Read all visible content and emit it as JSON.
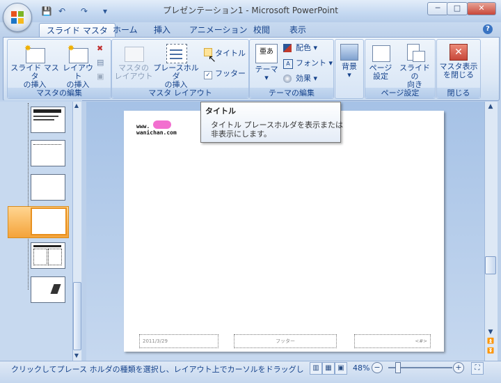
{
  "window": {
    "title": "プレゼンテーション1 - Microsoft PowerPoint",
    "minimize": "─",
    "maximize": "□",
    "close": "✕"
  },
  "quick_access": {
    "save": "💾",
    "undo": "↶",
    "redo": "↷",
    "customize": "▾"
  },
  "tabs": [
    "スライド マスタ",
    "ホーム",
    "挿入",
    "アニメーション",
    "校閲",
    "表示"
  ],
  "ribbon": {
    "group_master_edit": {
      "label": "マスタの編集",
      "insert_master_line1": "スライド マスタ",
      "insert_master_line2": "の挿入",
      "insert_layout_line1": "レイアウト",
      "insert_layout_line2": "の挿入"
    },
    "group_master_layout": {
      "label": "マスタ レイアウト",
      "master_layout_line1": "マスタの",
      "master_layout_line2": "レイアウト",
      "placeholder_line1": "プレースホルダ",
      "placeholder_line2": "の挿入",
      "title_check": "タイトル",
      "footer_check": "フッター"
    },
    "group_theme_edit": {
      "label": "テーマの編集",
      "theme": "テーマ",
      "colors": "配色",
      "fonts": "フォント",
      "effects": "効果",
      "theme_icon_text": "亜あ"
    },
    "group_background": {
      "background": "背景"
    },
    "group_page_setup": {
      "label": "ページ設定",
      "page_setup_line1": "ページ",
      "page_setup_line2": "設定",
      "orientation_line1": "スライドの",
      "orientation_line2": "向き"
    },
    "group_close": {
      "label": "閉じる",
      "close_line1": "マスタ表示",
      "close_line2": "を閉じる"
    }
  },
  "tooltip": {
    "title": "タイトル",
    "line1": "タイトル プレースホルダを表示または",
    "line2": "非表示にします。"
  },
  "slide": {
    "logo_line1": "www.",
    "logo_line2": "wanichan.com",
    "date": "2011/3/29",
    "footer": "フッター",
    "page_number": "<#>"
  },
  "status": {
    "message": "クリックしてプレース ホルダの種類を選択し、レイアウト上でカーソルをドラッグしてプレー...",
    "zoom": "48%"
  },
  "colors": {
    "accent": "#15428b",
    "selection": "#f4a33a",
    "close_red": "#c7473a"
  }
}
